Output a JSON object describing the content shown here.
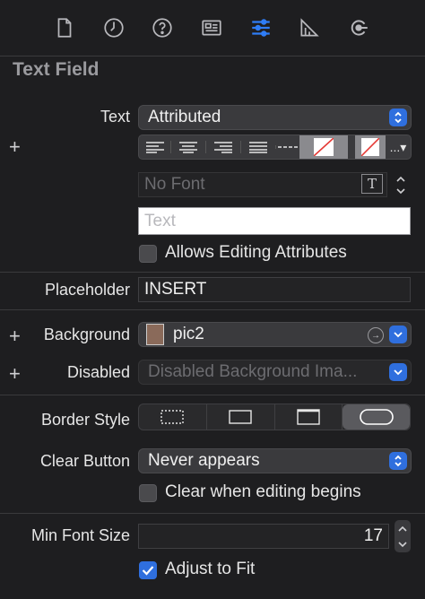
{
  "toolbar": {
    "icons": [
      "file-icon",
      "history-icon",
      "help-icon",
      "identity-icon",
      "attributes-icon",
      "size-icon",
      "connections-icon"
    ],
    "selected": "attributes-icon",
    "accent": "#2f7df6"
  },
  "section": {
    "title": "Text Field"
  },
  "text_row": {
    "label": "Text",
    "value": "Attributed"
  },
  "font_row": {
    "value": "No Font"
  },
  "text_input": {
    "placeholder": "Text"
  },
  "allows_editing": {
    "label": "Allows Editing Attributes",
    "checked": false
  },
  "placeholder_row": {
    "label": "Placeholder",
    "value": "INSERT"
  },
  "background_row": {
    "label": "Background",
    "value": "pic2"
  },
  "disabled_row": {
    "label": "Disabled",
    "value": "Disabled Background Ima..."
  },
  "border_style": {
    "label": "Border Style",
    "selected_index": 3
  },
  "clear_button": {
    "label": "Clear Button",
    "value": "Never appears"
  },
  "clear_when_editing": {
    "label": "Clear when editing begins",
    "checked": false
  },
  "min_font_size": {
    "label": "Min Font Size",
    "value": "17"
  },
  "adjust_to_fit": {
    "label": "Adjust to Fit",
    "checked": true
  },
  "colors": {
    "accent_blue": "#2f6fde",
    "panel_bg": "#1e1e20"
  }
}
